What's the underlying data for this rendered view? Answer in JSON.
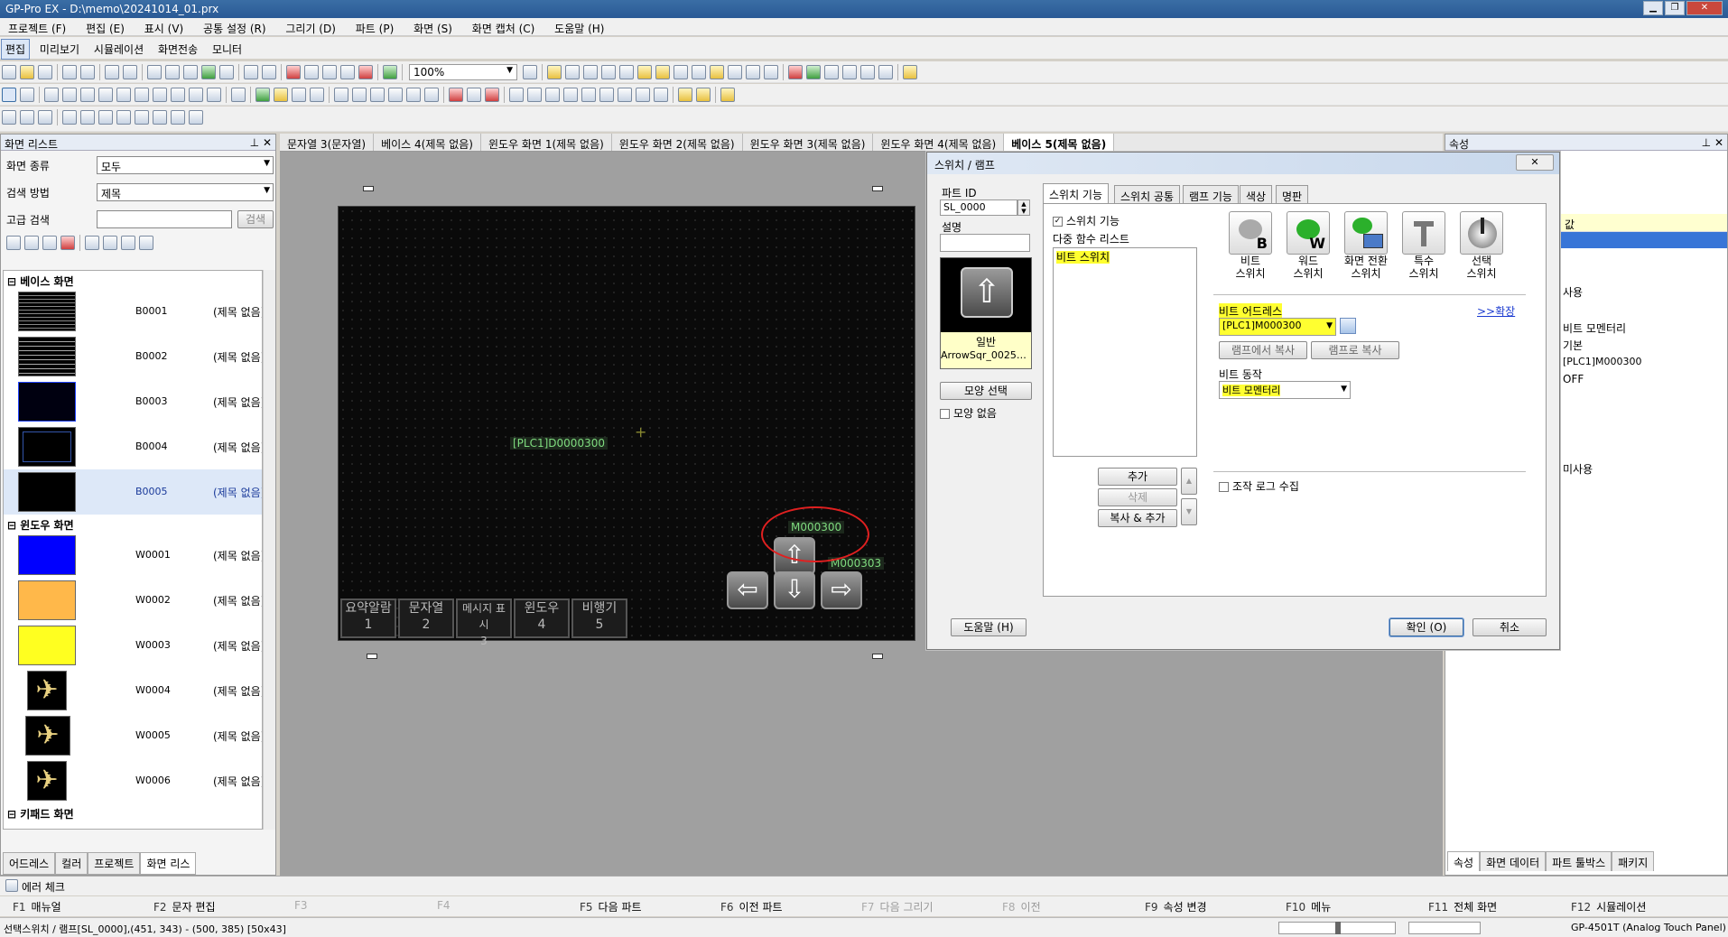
{
  "app": {
    "title": "GP-Pro EX - D:\\memo\\20241014_01.prx"
  },
  "menu": [
    "프로젝트 (F)",
    "편집 (E)",
    "표시 (V)",
    "공통 설정 (R)",
    "그리기 (D)",
    "파트 (P)",
    "화면 (S)",
    "화면 캡처 (C)",
    "도움말 (H)"
  ],
  "modes": [
    "편집",
    "미리보기",
    "시뮬레이션",
    "화면전송",
    "모니터"
  ],
  "toolbar": {
    "zoom": "100%"
  },
  "left_panel": {
    "title": "화면 리스트",
    "screen_type_label": "화면 종류",
    "screen_type_value": "모두",
    "search_method_label": "검색 방법",
    "search_method_value": "제목",
    "advanced_search_label": "고급 검색",
    "search_button": "검색",
    "groups": {
      "base": "베이스 화면",
      "window": "윈도우 화면",
      "keypad": "키패드 화면"
    },
    "base_screens": [
      {
        "code": "B0001",
        "name": "(제목 없음)"
      },
      {
        "code": "B0002",
        "name": "(제목 없음)"
      },
      {
        "code": "B0003",
        "name": "(제목 없음)"
      },
      {
        "code": "B0004",
        "name": "(제목 없음)"
      },
      {
        "code": "B0005",
        "name": "(제목 없음)"
      }
    ],
    "window_screens": [
      {
        "code": "W0001",
        "name": "(제목 없음)",
        "color": "#0000ff"
      },
      {
        "code": "W0002",
        "name": "(제목 없음)",
        "color": "#ffb84a"
      },
      {
        "code": "W0003",
        "name": "(제목 없음)",
        "color": "#ffff20"
      },
      {
        "code": "W0004",
        "name": "(제목 없음)",
        "color": "#000000"
      },
      {
        "code": "W0005",
        "name": "(제목 없음)",
        "color": "#000000"
      },
      {
        "code": "W0006",
        "name": "(제목 없음)",
        "color": "#000000"
      }
    ],
    "tabs": [
      "어드레스",
      "컬러",
      "프로젝트",
      "화면 리스"
    ]
  },
  "doc_tabs": [
    "문자열 3(문자열)",
    "베이스 4(제목 없음)",
    "윈도우 화면 1(제목 없음)",
    "윈도우 화면 2(제목 없음)",
    "윈도우 화면 3(제목 없음)",
    "윈도우 화면 4(제목 없음)",
    "베이스 5(제목 없음)"
  ],
  "canvas": {
    "label1": "[PLC1]D0000300",
    "label2": "M000300",
    "label3": "M000303",
    "bottom_buttons": [
      {
        "line1": "요약알람",
        "line2": "1"
      },
      {
        "line1": "문자열",
        "line2": "2"
      },
      {
        "line1": "메시지 표시",
        "line2": "3"
      },
      {
        "line1": "윈도우",
        "line2": "4"
      },
      {
        "line1": "비행기",
        "line2": "5"
      }
    ]
  },
  "dialog": {
    "title": "스위치 / 램프",
    "close": "✕",
    "part_id_label": "파트 ID",
    "part_id_value": "SL_0000",
    "description_label": "설명",
    "preview_caption1": "일반",
    "preview_caption2": "ArrowSqr_0025M...",
    "shape_select_button": "모양 선택",
    "no_shape_label": "모양 없음",
    "tabs": [
      "스위치 기능",
      "스위치 공통",
      "램프 기능",
      "색상",
      "명판"
    ],
    "switch_function_checkbox": "스위치 기능",
    "multi_function_label": "다중 함수 리스트",
    "function_list": [
      "비트 스위치"
    ],
    "switch_types": [
      {
        "line1": "비트",
        "line2": "스위치"
      },
      {
        "line1": "워드",
        "line2": "스위치"
      },
      {
        "line1": "화면 전환",
        "line2": "스위치"
      },
      {
        "line1": "특수",
        "line2": "스위치"
      },
      {
        "line1": "선택",
        "line2": "스위치"
      }
    ],
    "bit_address_label": "비트 어드레스",
    "expand_link": ">>확장",
    "bit_address_value": "[PLC1]M000300",
    "copy_from_lamp": "램프에서 복사",
    "copy_to_lamp": "램프로 복사",
    "bit_action_label": "비트 동작",
    "bit_action_value": "비트 모멘터리",
    "add_button": "추가",
    "delete_button": "삭제",
    "copy_add_button": "복사 & 추가",
    "log_label": "조작 로그 수집",
    "help_button": "도움말 (H)",
    "ok_button": "확인 (O)",
    "cancel_button": "취소"
  },
  "right_panel": {
    "title": "속성",
    "value_header": "값",
    "values": [
      "사용",
      "비트 모멘터리",
      "기본",
      "[PLC1]M000300",
      "OFF",
      "미사용"
    ],
    "tabs": [
      "속성",
      "화면 데이터",
      "파트 툴박스",
      "패키지"
    ]
  },
  "error_check": "에러 체크",
  "fkeys": [
    {
      "key": "F1",
      "label": "매뉴얼",
      "enabled": true
    },
    {
      "key": "F2",
      "label": "문자 편집",
      "enabled": true
    },
    {
      "key": "F3",
      "label": "",
      "enabled": false
    },
    {
      "key": "F4",
      "label": "",
      "enabled": false
    },
    {
      "key": "F5",
      "label": "다음 파트",
      "enabled": true
    },
    {
      "key": "F6",
      "label": "이전 파트",
      "enabled": true
    },
    {
      "key": "F7",
      "label": "다음 그리기",
      "enabled": false
    },
    {
      "key": "F8",
      "label": "이전",
      "enabled": false
    },
    {
      "key": "F9",
      "label": "속성 변경",
      "enabled": true
    },
    {
      "key": "F10",
      "label": "메뉴",
      "enabled": true
    },
    {
      "key": "F11",
      "label": "전체 화면",
      "enabled": true
    },
    {
      "key": "F12",
      "label": "시뮬레이션",
      "enabled": true
    }
  ],
  "status": {
    "left": "선택스위치 / 램프[SL_0000],(451, 343) - (500, 385) [50x43]",
    "right": "GP-4501T (Analog Touch Panel)"
  }
}
